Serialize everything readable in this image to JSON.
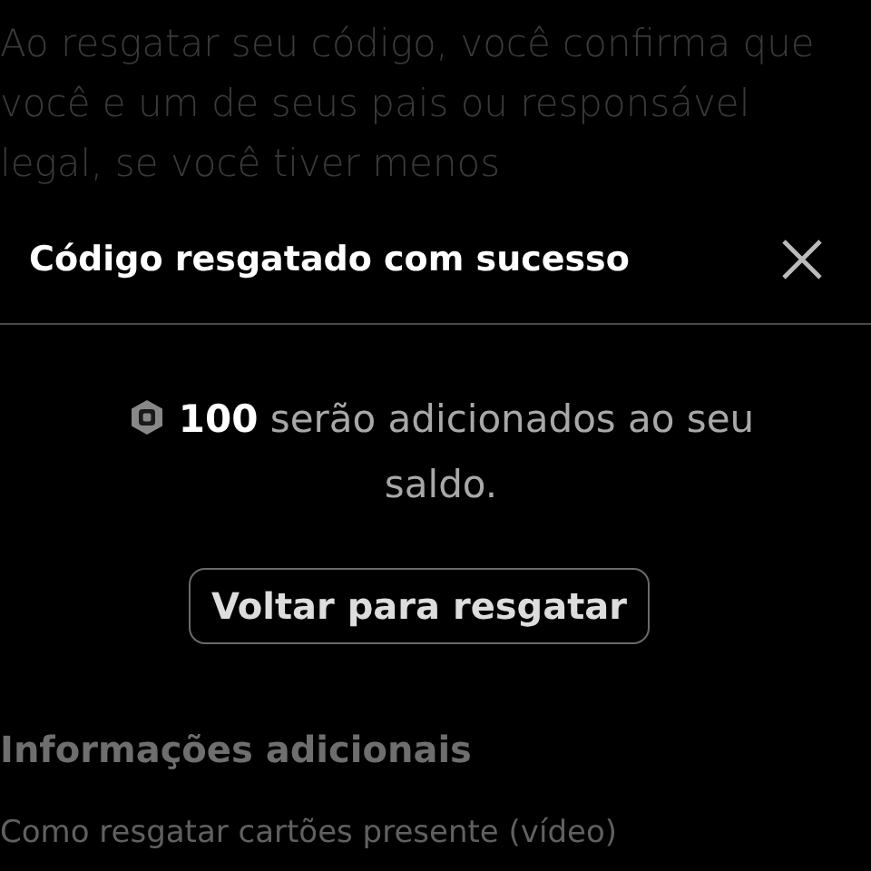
{
  "background_paragraph": "Ao resgatar seu código, você confirma que você e um de seus pais ou responsável legal, se você tiver menos",
  "dialog": {
    "title": "Código resgatado com sucesso",
    "message": {
      "amount": "100",
      "text": "serão adicionados ao seu saldo."
    },
    "button": "Voltar para resgatar"
  },
  "additional_info": {
    "heading": "Informações adicionais",
    "link": "Como resgatar cartões presente (vídeo)"
  }
}
